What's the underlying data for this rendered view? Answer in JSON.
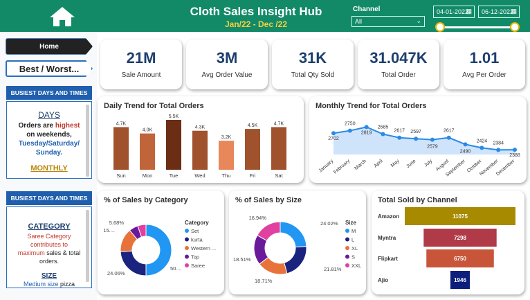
{
  "header": {
    "title": "Cloth Sales Insight Hub",
    "subtitle": "Jan/22 - Dec /22",
    "channel_label": "Channel",
    "channel_value": "All",
    "date_from": "04-01-2022",
    "date_to": "06-12-2022",
    "home_icon": "home-icon"
  },
  "nav": {
    "home": "Home",
    "best_worst": "Best / Worst..."
  },
  "panel1": {
    "head": "BUSIEST DAYS AND TIMES",
    "title": "DAYS",
    "line1a": "Orders are ",
    "line1b": "highest",
    "line1c": " on weekends,",
    "line2": "Tuesday/Saturday/",
    "line3": "Sunday.",
    "more": "MONTHLY"
  },
  "panel2": {
    "head": "BUSIEST DAYS AND TIMES",
    "title": "CATEGORY",
    "line1": "Saree Category contributes to",
    "line2a": "maximum",
    "line2b": " sales & total orders.",
    "title2": "SIZE",
    "line3a": "Medium size",
    "line3b": " pizza"
  },
  "kpis": [
    {
      "value": "21M",
      "label": "Sale Amount"
    },
    {
      "value": "3M",
      "label": "Avg Order Value"
    },
    {
      "value": "31K",
      "label": "Total Qty Sold"
    },
    {
      "value": "31.047K",
      "label": "Total Order"
    },
    {
      "value": "1.01",
      "label": "Avg Per Order"
    }
  ],
  "colors": {
    "header": "#138a67",
    "accent": "#f4d03f",
    "kpi_text": "#1d3f6e"
  },
  "chart_data": [
    {
      "type": "bar",
      "title": "Daily Trend for Total Orders",
      "categories": [
        "Sun",
        "Mon",
        "Tue",
        "Wed",
        "Thu",
        "Fri",
        "Sat"
      ],
      "values": [
        4.7,
        4.0,
        5.5,
        4.3,
        3.2,
        4.5,
        4.7
      ],
      "labels": [
        "4.7K",
        "4.0K",
        "5.5K",
        "4.3K",
        "3.2K",
        "4.5K",
        "4.7K"
      ],
      "colors": [
        "#a0522d",
        "#c0653a",
        "#6b2e14",
        "#a0522d",
        "#e8875a",
        "#a0522d",
        "#a0522d"
      ],
      "ylim": [
        0,
        5.5
      ]
    },
    {
      "type": "area",
      "title": "Monthly Trend for Total Orders",
      "categories": [
        "January",
        "February",
        "March",
        "April",
        "May",
        "June",
        "July",
        "August",
        "September",
        "October",
        "November",
        "December"
      ],
      "values": [
        2702,
        2750,
        2819,
        2685,
        2617,
        2597,
        2579,
        2617,
        2490,
        2424,
        2384,
        2388
      ],
      "ylim": [
        2350,
        2850
      ]
    },
    {
      "type": "pie",
      "title": "% of Sales by Category",
      "legend_title": "Category",
      "series": [
        {
          "name": "Set",
          "value": 50.0,
          "color": "#2196f3"
        },
        {
          "name": "kurta",
          "value": 24.06,
          "color": "#1a237e"
        },
        {
          "name": "Western ...",
          "value": 15.0,
          "color": "#e8733a"
        },
        {
          "name": "Top",
          "value": 5.68,
          "color": "#6a1b9a"
        },
        {
          "name": "Saree",
          "value": 5.26,
          "color": "#e040a0"
        }
      ],
      "labels": [
        "50....",
        "24.06%",
        "15....",
        "5.68%"
      ]
    },
    {
      "type": "pie",
      "title": "% of Sales by Size",
      "legend_title": "Size",
      "series": [
        {
          "name": "M",
          "value": 24.02,
          "color": "#2196f3"
        },
        {
          "name": "L",
          "value": 21.81,
          "color": "#1a237e"
        },
        {
          "name": "XL",
          "value": 18.71,
          "color": "#e8733a"
        },
        {
          "name": "S",
          "value": 18.51,
          "color": "#6a1b9a"
        },
        {
          "name": "XXL",
          "value": 16.94,
          "color": "#e040a0"
        }
      ],
      "labels": [
        "24.02%",
        "21.81%",
        "18.71%",
        "18.51%",
        "16.94%"
      ]
    },
    {
      "type": "bar",
      "title": "Total Sold by Channel",
      "categories": [
        "Amazon",
        "Myntra",
        "Flipkart",
        "Ajio"
      ],
      "values": [
        11075,
        7298,
        6750,
        1946
      ],
      "colors": [
        "#a88a00",
        "#b03a48",
        "#c8553a",
        "#0d1f7a"
      ],
      "xlim": [
        0,
        11075
      ]
    }
  ]
}
